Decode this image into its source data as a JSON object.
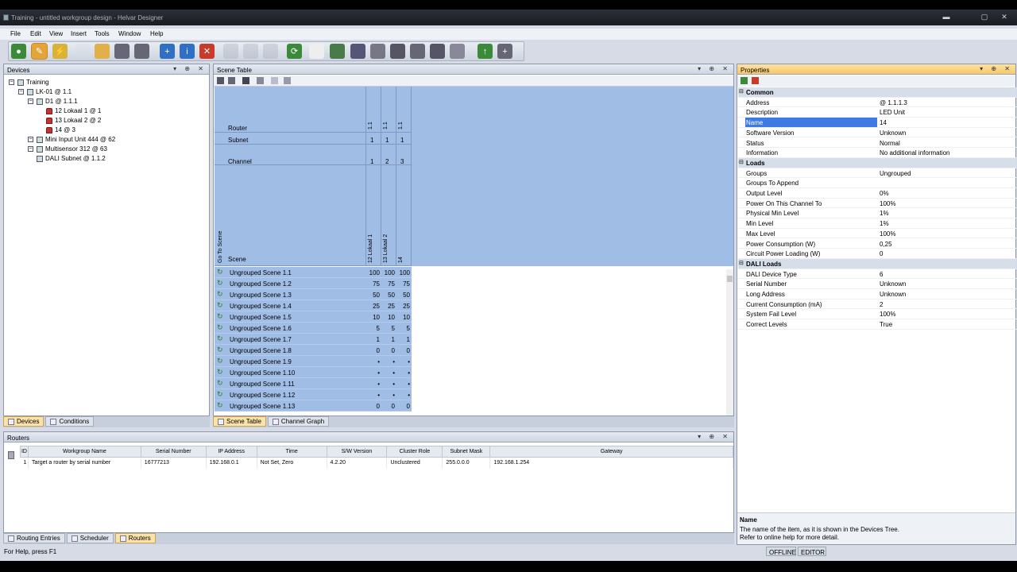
{
  "window": {
    "title": "Training - untitled workgroup design - Helvar Designer"
  },
  "menu": [
    "File",
    "Edit",
    "View",
    "Insert",
    "Tools",
    "Window",
    "Help"
  ],
  "toolbar": {
    "icons": [
      "earth-icon",
      "pencil-icon",
      "lightning-icon",
      "new-file-icon",
      "open-folder-icon",
      "save-icon",
      "save-all-icon",
      "add-icon",
      "info-icon",
      "stop-icon",
      "cut-icon",
      "copy-icon",
      "paste-icon",
      "refresh-icon",
      "report-icon",
      "grid-icon",
      "layout-icon",
      "table-icon",
      "network-icon",
      "link-icon",
      "tools-icon",
      "gauge-icon",
      "upload-icon",
      "plus-icon"
    ],
    "colors": {
      "green": "#3a8a3a",
      "blue": "#2f6fc4",
      "red": "#c83a2a"
    }
  },
  "devices": {
    "title": "Devices",
    "tree": [
      {
        "label": "Training",
        "indent": 0
      },
      {
        "label": "LK-01 @ 1.1",
        "indent": 1
      },
      {
        "label": "D1 @ 1.1.1",
        "indent": 2
      },
      {
        "label": "12 Lokaal 1 @ 1",
        "indent": 3
      },
      {
        "label": "13 Lokaal 2 @ 2",
        "indent": 3
      },
      {
        "label": "14 @ 3",
        "indent": 3
      },
      {
        "label": "Mini Input Unit 444 @ 62",
        "indent": 2
      },
      {
        "label": "Multisensor 312 @ 63",
        "indent": 2
      },
      {
        "label": "DALI Subnet @ 1.1.2",
        "indent": 2
      }
    ],
    "tabs": [
      "Devices",
      "Conditions"
    ]
  },
  "scene": {
    "title": "Scene Table",
    "labels": {
      "router": "Router",
      "subnet": "Subnet",
      "channel": "Channel",
      "go": "Go To Scene",
      "scene": "Scene"
    },
    "router_vals": [
      "1.1",
      "1.1",
      "1.1"
    ],
    "subnet_vals": [
      "1",
      "1",
      "1"
    ],
    "channel_vals": [
      "1",
      "2",
      "3"
    ],
    "channel_names": [
      "12 Lokaal 1",
      "13 Lokaal 2",
      "14"
    ],
    "rows": [
      {
        "name": "Ungrouped Scene 1.1",
        "v": [
          "100",
          "100",
          "100"
        ]
      },
      {
        "name": "Ungrouped Scene 1.2",
        "v": [
          "75",
          "75",
          "75"
        ]
      },
      {
        "name": "Ungrouped Scene 1.3",
        "v": [
          "50",
          "50",
          "50"
        ]
      },
      {
        "name": "Ungrouped Scene 1.4",
        "v": [
          "25",
          "25",
          "25"
        ]
      },
      {
        "name": "Ungrouped Scene 1.5",
        "v": [
          "10",
          "10",
          "10"
        ]
      },
      {
        "name": "Ungrouped Scene 1.6",
        "v": [
          "5",
          "5",
          "5"
        ]
      },
      {
        "name": "Ungrouped Scene 1.7",
        "v": [
          "1",
          "1",
          "1"
        ]
      },
      {
        "name": "Ungrouped Scene 1.8",
        "v": [
          "0",
          "0",
          "0"
        ]
      },
      {
        "name": "Ungrouped Scene 1.9",
        "v": [
          "•",
          "•",
          "•"
        ]
      },
      {
        "name": "Ungrouped Scene 1.10",
        "v": [
          "•",
          "•",
          "•"
        ]
      },
      {
        "name": "Ungrouped Scene 1.11",
        "v": [
          "•",
          "•",
          "•"
        ]
      },
      {
        "name": "Ungrouped Scene 1.12",
        "v": [
          "•",
          "•",
          "•"
        ]
      },
      {
        "name": "Ungrouped Scene 1.13",
        "v": [
          "0",
          "0",
          "0"
        ]
      }
    ],
    "tabs": [
      "Scene Table",
      "Channel Graph"
    ]
  },
  "properties": {
    "title": "Properties",
    "rows": [
      {
        "k": "Common",
        "cat": true
      },
      {
        "k": "Address",
        "v": "@ 1.1.1.3"
      },
      {
        "k": "Description",
        "v": "LED Unit"
      },
      {
        "k": "Name",
        "v": "14",
        "sel": true
      },
      {
        "k": "Software Version",
        "v": "Unknown"
      },
      {
        "k": "Status",
        "v": "Normal"
      },
      {
        "k": "Information",
        "v": "No additional information"
      },
      {
        "k": "Loads",
        "cat": true
      },
      {
        "k": "Groups",
        "v": "Ungrouped"
      },
      {
        "k": "Groups To Append",
        "v": ""
      },
      {
        "k": "Output Level",
        "v": "0%"
      },
      {
        "k": "Power On This Channel To",
        "v": "100%"
      },
      {
        "k": "Physical Min Level",
        "v": "1%"
      },
      {
        "k": "Min Level",
        "v": "1%"
      },
      {
        "k": "Max Level",
        "v": "100%"
      },
      {
        "k": "Power Consumption (W)",
        "v": "0,25"
      },
      {
        "k": "Circuit Power Loading (W)",
        "v": "0"
      },
      {
        "k": "DALI Loads",
        "cat": true
      },
      {
        "k": "DALI Device Type",
        "v": "6"
      },
      {
        "k": "Serial Number",
        "v": "Unknown"
      },
      {
        "k": "Long Address",
        "v": "Unknown"
      },
      {
        "k": "Current Consumption (mA)",
        "v": "2"
      },
      {
        "k": "System Fail Level",
        "v": "100%"
      },
      {
        "k": "Correct Levels",
        "v": "True"
      }
    ],
    "help_title": "Name",
    "help_text1": "The name of the item, as it is shown in the Devices Tree.",
    "help_text2": "Refer to online help for more detail."
  },
  "routers": {
    "title": "Routers",
    "headers": [
      "ID",
      "Workgroup Name",
      "Serial Number",
      "IP Address",
      "Time",
      "S/W Version",
      "Cluster Role",
      "Subnet Mask",
      "Gateway"
    ],
    "rows": [
      [
        "1",
        "Target a router by serial number",
        "16777213",
        "192.168.0.1",
        "Not Set, Zero",
        "4.2.20",
        "Unclustered",
        "255.0.0.0",
        "192.168.1.254"
      ]
    ],
    "tabs": [
      "Routing Entries",
      "Scheduler",
      "Routers"
    ]
  },
  "status": {
    "help": "For Help, press F1",
    "offline": "OFFLINE",
    "editor": "EDITOR"
  }
}
